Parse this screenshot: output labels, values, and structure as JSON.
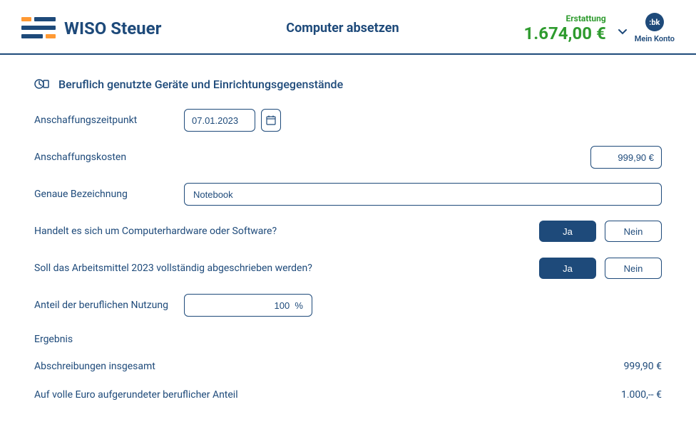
{
  "header": {
    "logo_text": "WISO Steuer",
    "page_title": "Computer absetzen",
    "refund_label": "Erstattung",
    "refund_amount": "1.674,00 €",
    "account_badge": ":bk",
    "account_label": "Mein Konto"
  },
  "section": {
    "title": "Beruflich genutzte Geräte und Einrichtungsgegenstände"
  },
  "form": {
    "purchase_date": {
      "label": "Anschaffungszeitpunkt",
      "value": "07.01.2023"
    },
    "purchase_cost": {
      "label": "Anschaffungskosten",
      "value": "999,90 €"
    },
    "designation": {
      "label": "Genaue Bezeichnung",
      "value": "Notebook"
    },
    "is_hardware": {
      "label": "Handelt es sich um Computerhardware oder Software?",
      "yes": "Ja",
      "no": "Nein"
    },
    "full_writeoff": {
      "label": "Soll das Arbeitsmittel 2023 vollständig abgeschrieben werden?",
      "yes": "Ja",
      "no": "Nein"
    },
    "business_share": {
      "label": "Anteil der beruflichen Nutzung",
      "value": "100  %"
    }
  },
  "result": {
    "header": "Ergebnis",
    "depreciation_label": "Abschreibungen insgesamt",
    "depreciation_value": "999,90 €",
    "rounded_label": "Auf volle Euro aufgerundeter beruflicher Anteil",
    "rounded_value": "1.000,-- €"
  }
}
